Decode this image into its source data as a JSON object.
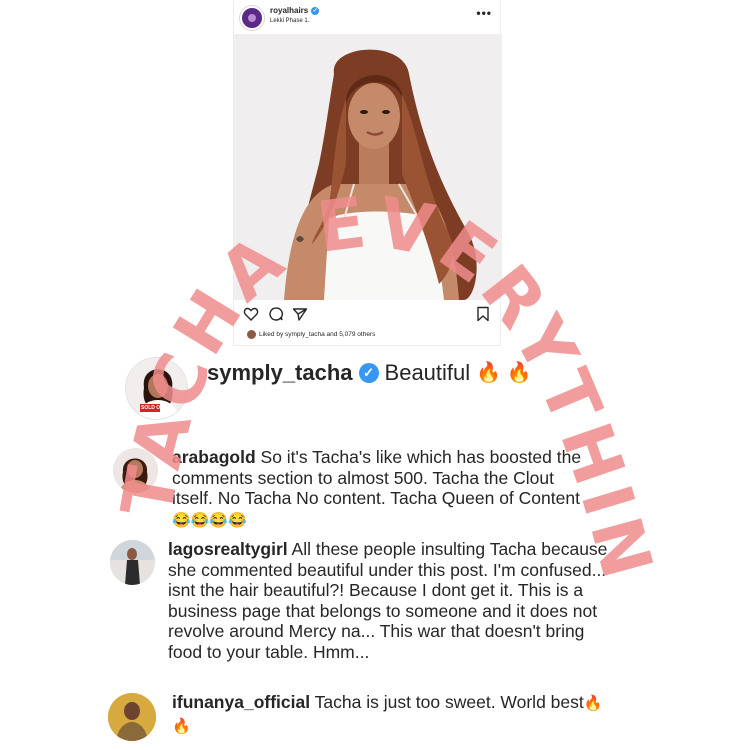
{
  "post": {
    "username": "royalhairs",
    "location": "Lekki Phase 1.",
    "more_label": "•••",
    "liked_by_text": "Liked by symply_tacha and 5,079 others",
    "verified_glyph": "✓",
    "icons": [
      "heart-icon",
      "comment-icon",
      "share-icon",
      "bookmark-icon"
    ]
  },
  "main_comment": {
    "username": "symply_tacha",
    "verified_glyph": "✓",
    "text": "Beautiful",
    "emoji": "🔥 🔥",
    "avatar_badge": "SOLD OUT"
  },
  "comments": [
    {
      "username": "arabagold",
      "text": "So it's Tacha's like which has boosted the comments section to almost 500. Tacha the Clout itself. No Tacha No content. Tacha Queen of Content",
      "emoji": "😂😂😂😂"
    },
    {
      "username": "lagosrealtygirl",
      "text": "All these people insulting Tacha because she commented beautiful under this post. I'm confused... isnt the hair beautiful?! Because I dont get it. This is a business page that belongs to someone and it does not revolve around Mercy na... This war that doesn't bring food to your table. Hmm...",
      "emoji": ""
    },
    {
      "username": "ifunanya_official",
      "text": "Tacha is just too sweet. World best",
      "emoji": "🔥 🔥"
    }
  ],
  "watermark": {
    "text": "TACHA EVERYTHING",
    "color": "#f08c8c"
  },
  "colors": {
    "verified": "#3897f0",
    "text": "#262626",
    "hair": "#8a4a2e",
    "dress": "#f8f8f6"
  }
}
